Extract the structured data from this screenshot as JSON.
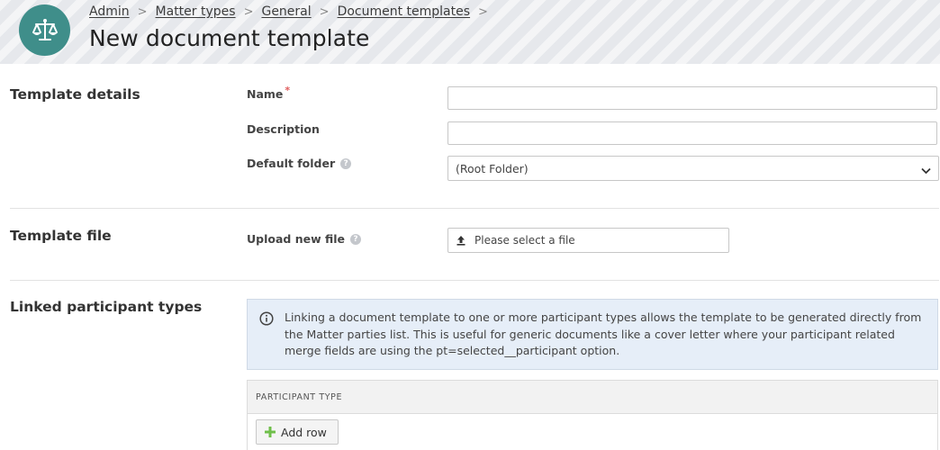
{
  "header": {
    "breadcrumb": [
      "Admin",
      "Matter types",
      "General",
      "Document templates"
    ],
    "separator": ">",
    "title": "New document template",
    "logo_icon": "scales-of-justice-icon",
    "logo_color": "#3f8e8a"
  },
  "sections": {
    "template_details": {
      "title": "Template details",
      "name_label": "Name",
      "name_required_mark": "*",
      "name_value": "",
      "description_label": "Description",
      "description_value": "",
      "default_folder_label": "Default folder",
      "default_folder_value": "(Root Folder)"
    },
    "template_file": {
      "title": "Template file",
      "upload_label": "Upload new file",
      "upload_placeholder": "Please select a file"
    },
    "linked_participants": {
      "title": "Linked participant types",
      "info_text": "Linking a document template to one or more participant types allows the template to be generated directly from the Matter parties list. This is useful for generic documents like a cover letter where your participant related merge fields are using the pt=selected__participant option.",
      "table_header": "PARTICIPANT TYPE",
      "add_row_label": "Add row"
    }
  },
  "colors": {
    "required": "#e05c5c",
    "info_bg": "#e6eef8",
    "add_icon": "#6fbf4a"
  }
}
